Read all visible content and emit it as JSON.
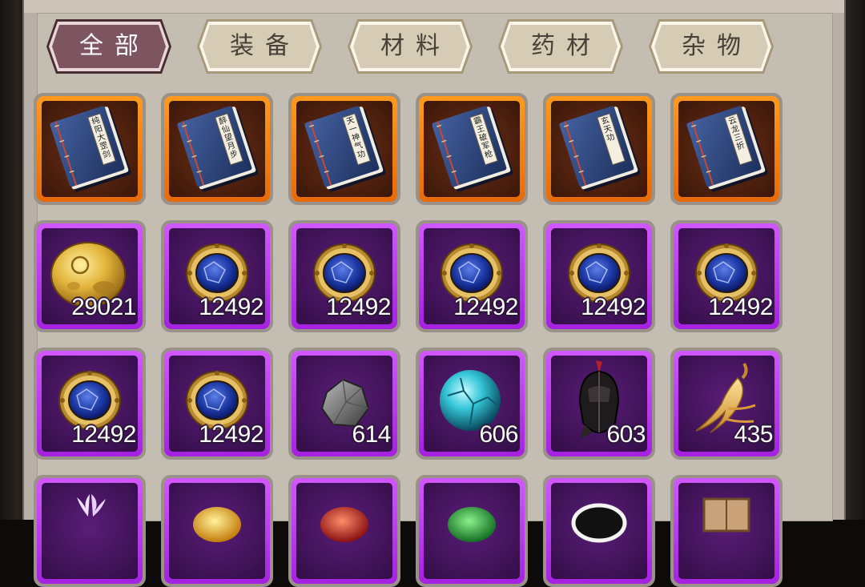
{
  "tabs": [
    {
      "label": "全部",
      "active": true
    },
    {
      "label": "装备",
      "active": false
    },
    {
      "label": "材料",
      "active": false
    },
    {
      "label": "药材",
      "active": false
    },
    {
      "label": "杂物",
      "active": false
    }
  ],
  "colors": {
    "tab_active_fill": "#7d5560",
    "tab_inactive_fill": "#d6cbb4",
    "rarity_orange": "#ff8c14",
    "rarity_purple": "#c03cf0"
  },
  "rows": [
    [
      {
        "icon": "manual-book-icon",
        "rarity": "orange",
        "count": "",
        "title": "纯阳大罡剑"
      },
      {
        "icon": "manual-book-icon",
        "rarity": "orange",
        "count": "",
        "title": "醉仙望月步"
      },
      {
        "icon": "manual-book-icon",
        "rarity": "orange",
        "count": "",
        "title": "天一神气功"
      },
      {
        "icon": "manual-book-icon",
        "rarity": "orange",
        "count": "",
        "title": "霸王破军枪"
      },
      {
        "icon": "manual-book-icon",
        "rarity": "orange",
        "count": "",
        "title": "玄天功"
      },
      {
        "icon": "manual-book-icon",
        "rarity": "orange",
        "count": "",
        "title": "云龙三折"
      }
    ],
    [
      {
        "icon": "gold-coin-icon",
        "rarity": "purple",
        "count": "29021"
      },
      {
        "icon": "sapphire-medallion-icon",
        "rarity": "purple",
        "count": "12492"
      },
      {
        "icon": "sapphire-medallion-icon",
        "rarity": "purple",
        "count": "12492"
      },
      {
        "icon": "sapphire-medallion-icon",
        "rarity": "purple",
        "count": "12492"
      },
      {
        "icon": "sapphire-medallion-icon",
        "rarity": "purple",
        "count": "12492"
      },
      {
        "icon": "sapphire-medallion-icon",
        "rarity": "purple",
        "count": "12492"
      }
    ],
    [
      {
        "icon": "sapphire-medallion-icon",
        "rarity": "purple",
        "count": "12492"
      },
      {
        "icon": "sapphire-medallion-icon",
        "rarity": "purple",
        "count": "12492"
      },
      {
        "icon": "iron-ore-icon",
        "rarity": "purple",
        "count": "614"
      },
      {
        "icon": "cyan-orb-icon",
        "rarity": "purple",
        "count": "606"
      },
      {
        "icon": "helmet-icon",
        "rarity": "purple",
        "count": "603"
      },
      {
        "icon": "ginseng-icon",
        "rarity": "purple",
        "count": "435"
      }
    ],
    [
      {
        "icon": "flower-icon",
        "rarity": "purple",
        "count": ""
      },
      {
        "icon": "gold-orb-icon",
        "rarity": "purple",
        "count": ""
      },
      {
        "icon": "red-orb-icon",
        "rarity": "purple",
        "count": ""
      },
      {
        "icon": "green-orb-icon",
        "rarity": "purple",
        "count": ""
      },
      {
        "icon": "pearl-icon",
        "rarity": "purple",
        "count": ""
      },
      {
        "icon": "wooden-box-icon",
        "rarity": "purple",
        "count": ""
      }
    ]
  ]
}
